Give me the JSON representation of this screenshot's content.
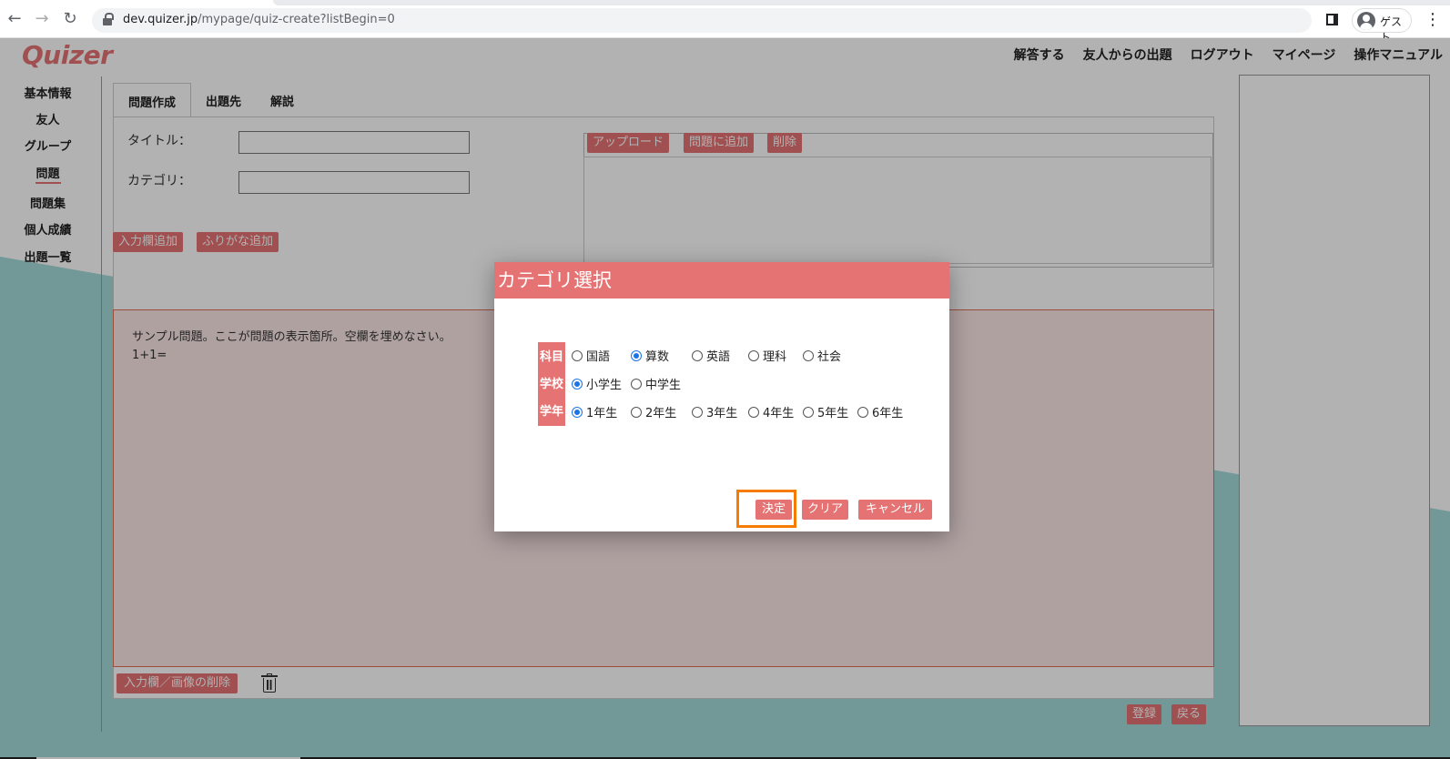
{
  "browser": {
    "url_host": "dev.quizer.jp",
    "url_path": "/mypage/quiz-create?listBegin=0",
    "profile_name": "ゲスト"
  },
  "app": {
    "logo": "Quizer",
    "topnav": [
      "解答する",
      "友人からの出題",
      "ログアウト",
      "マイページ",
      "操作マニュアル"
    ],
    "sidebar": [
      "基本情報",
      "友人",
      "グループ",
      "問題",
      "問題集",
      "個人成績",
      "出題一覧"
    ],
    "sidebar_active": "問題",
    "tabs": [
      "問題作成",
      "出題先",
      "解説"
    ],
    "form": {
      "title_label": "タイトル：",
      "title_value": "",
      "category_label": "カテゴリ：",
      "category_value": ""
    },
    "buttons": {
      "add_input": "入力欄追加",
      "add_furigana": "ふりがな追加",
      "upload": "アップロード",
      "add_to_question": "問題に追加",
      "delete": "削除",
      "delete_input_image": "入力欄／画像の削除",
      "register": "登録",
      "back": "戻る"
    },
    "question_text": "サンプル問題。ここが問題の表示箇所。空欄を埋めなさい。\n1+1="
  },
  "modal": {
    "title": "カテゴリ選択",
    "row_labels": [
      "科目",
      "学校",
      "学年"
    ],
    "subject_options": [
      "国語",
      "算数",
      "英語",
      "理科",
      "社会"
    ],
    "subject_selected": "算数",
    "school_options": [
      "小学生",
      "中学生"
    ],
    "school_selected": "小学生",
    "grade_options": [
      "1年生",
      "2年生",
      "3年生",
      "4年生",
      "5年生",
      "6年生"
    ],
    "grade_selected": "1年生",
    "buttons": {
      "confirm": "決定",
      "clear": "クリア",
      "cancel": "キャンセル"
    }
  },
  "colors": {
    "accent": "#e57373",
    "teal": "#a5dada",
    "highlight": "#f57c00",
    "radio_selected": "#1a73e8"
  }
}
